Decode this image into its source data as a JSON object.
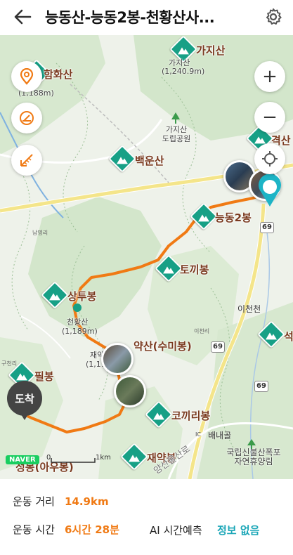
{
  "header": {
    "title": "능동산-능동2봉-천황산사...",
    "back_icon": "back-arrow-icon",
    "settings_icon": "gear-icon"
  },
  "map": {
    "peaks": {
      "gajisan": {
        "name": "가지산",
        "sub_name": "가지산",
        "elevation": "(1,240.9m)"
      },
      "hamhwasan": {
        "name": "함화산",
        "elevation": "(1,188m)"
      },
      "baegunsan": {
        "name": "백운산"
      },
      "gyeoksan": {
        "name": "격산"
      },
      "neungdong2": {
        "name": "능동2봉"
      },
      "tokkibong": {
        "name": "토끼봉"
      },
      "sangtubong": {
        "name": "상투봉"
      },
      "cheonhwangsan": {
        "name": "천황산",
        "elevation": "(1,189m)"
      },
      "jaeyaksan_sumi": {
        "name": "약산(수미봉)"
      },
      "jaeyak_sub": {
        "name": "재약",
        "elevation": "(1,119."
      },
      "pilbong": {
        "name": "필봉"
      },
      "kokkiribong": {
        "name": "코끼리봉"
      },
      "jaeyakbong": {
        "name": "재약봉"
      },
      "ahobong": {
        "name": "정봉(아우봉)"
      },
      "seok": {
        "name": "석"
      }
    },
    "places": {
      "gaji_park": "가지산\n도립공원",
      "icheoncheon": "이천천",
      "baenaegol": "배내골",
      "ic_label": "IC",
      "waterfall": "국립신불산폭포\n자연휴양림",
      "nammyeong": "남명리",
      "icheonri": "이천리",
      "gucheonri": "구천리",
      "road_name": "양산울산로"
    },
    "road_numbers": {
      "r69_top": "69",
      "r69_mid": "69",
      "r69_bottom": "69"
    },
    "arrive_label": "도착",
    "naver_label": "NAVER",
    "scale": {
      "start": "0",
      "end": "1km"
    },
    "controls": {
      "location": "location-pin-icon",
      "compass": "compass-icon",
      "ruler": "ruler-icon",
      "zoom_in": "+",
      "zoom_out": "−",
      "gps": "crosshair-icon"
    },
    "colors": {
      "route": "#f07a14",
      "mountain_badge": "#17a086",
      "road_main": "#f4e58a",
      "water": "#7fb2e0",
      "green": "#cfe4c6"
    }
  },
  "info": {
    "distance_label": "운동 거리",
    "distance_value": "14.9km",
    "time_label": "운동 시간",
    "time_value": "6시간 28분",
    "ai_label": "AI 시간예측",
    "ai_value": "정보 없음"
  }
}
